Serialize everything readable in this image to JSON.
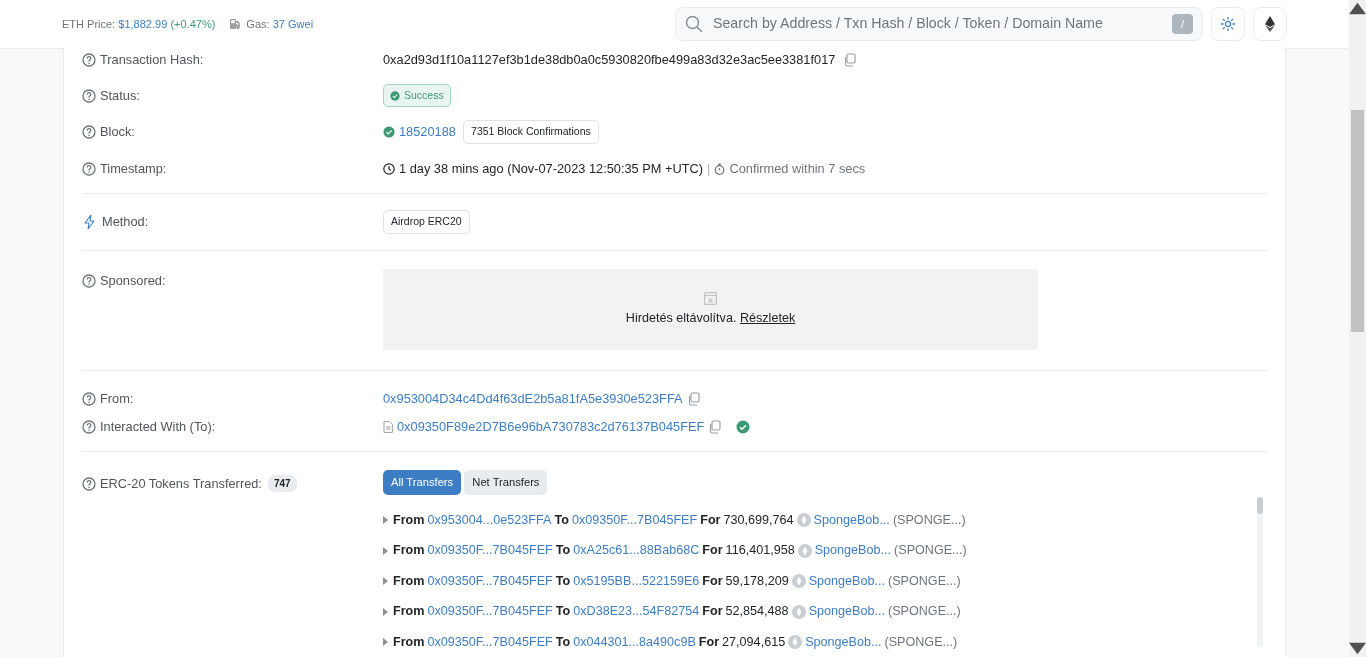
{
  "header": {
    "eth_price_label": "ETH Price:",
    "eth_price": "$1,882.99",
    "eth_change": "(+0.47%)",
    "gas_label": "Gas:",
    "gas_value": "37 Gwei",
    "search": {
      "placeholder": "Search by Address / Txn Hash / Block / Token / Domain Name",
      "shortcut": "/"
    }
  },
  "transaction_hash": {
    "label": "Transaction Hash:",
    "value": "0xa2d93d1f10a1127ef3b1de38db0a0c5930820fbe499a83d32e3ac5ee3381f017"
  },
  "status": {
    "label": "Status:",
    "value": "Success"
  },
  "block": {
    "label": "Block:",
    "number": "18520188",
    "confirmations": "7351 Block Confirmations"
  },
  "timestamp": {
    "label": "Timestamp:",
    "age": "1 day 38 mins ago (Nov-07-2023 12:50:35 PM +UTC)",
    "separator": "|",
    "confirmed": "Confirmed within 7 secs"
  },
  "method": {
    "label": "Method:",
    "value": "Airdrop ERC20"
  },
  "sponsored": {
    "label": "Sponsored:",
    "text": "Hirdetés eltávolítva.",
    "link": "Részletek"
  },
  "from": {
    "label": "From:",
    "address": "0x953004D34c4Dd4f63dE2b5a81fA5e3930e523FFA"
  },
  "interacted_with": {
    "label": "Interacted With (To):",
    "address": "0x09350F89e2D7B6e96bA730783c2d76137B045FEF",
    "verified": true
  },
  "erc20": {
    "label": "ERC-20 Tokens Transferred:",
    "count": "747",
    "tabs": [
      {
        "label": "All Transfers",
        "selected": true
      },
      {
        "label": "Net Transfers",
        "selected": false
      }
    ],
    "transfers": [
      {
        "from_word": "From",
        "from": "0x953004...0e523FFA",
        "to_word": "To",
        "to": "0x09350F...7B045FEF",
        "for_word": "For",
        "amount": "730,699,764",
        "token": "SpongeBob...",
        "symbol": "(SPONGE...)"
      },
      {
        "from_word": "From",
        "from": "0x09350F...7B045FEF",
        "to_word": "To",
        "to": "0xA25c61...88Bab68C",
        "for_word": "For",
        "amount": "116,401,958",
        "token": "SpongeBob...",
        "symbol": "(SPONGE...)"
      },
      {
        "from_word": "From",
        "from": "0x09350F...7B045FEF",
        "to_word": "To",
        "to": "0x5195BB...522159E6",
        "for_word": "For",
        "amount": "59,178,209",
        "token": "SpongeBob...",
        "symbol": "(SPONGE...)"
      },
      {
        "from_word": "From",
        "from": "0x09350F...7B045FEF",
        "to_word": "To",
        "to": "0xD38E23...54F82754",
        "for_word": "For",
        "amount": "52,854,488",
        "token": "SpongeBob...",
        "symbol": "(SPONGE...)"
      },
      {
        "from_word": "From",
        "from": "0x09350F...7B045FEF",
        "to_word": "To",
        "to": "0x044301...8a490c9B",
        "for_word": "For",
        "amount": "27,094,615",
        "token": "SpongeBob...",
        "symbol": "(SPONGE...)"
      }
    ]
  }
}
